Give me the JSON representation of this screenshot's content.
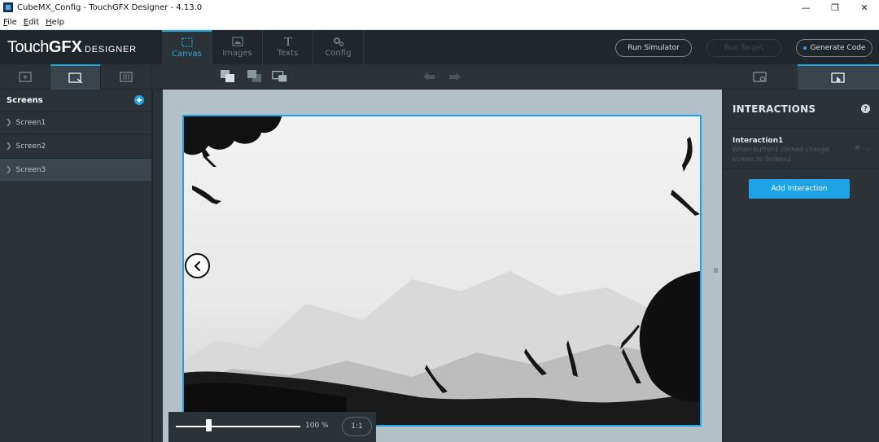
{
  "window": {
    "title": "CubeMX_Config - TouchGFX Designer - 4.13.0",
    "controls": [
      "—",
      "❐",
      "✕"
    ]
  },
  "menu": [
    "File",
    "Edit",
    "Help"
  ],
  "brand": {
    "part1": "Touch",
    "part2": "GFX",
    "part3": "DESIGNER"
  },
  "nav_tabs": [
    {
      "label": "Canvas",
      "icon": "canvas-icon",
      "active": true
    },
    {
      "label": "Images",
      "icon": "images-icon",
      "active": false
    },
    {
      "label": "Texts",
      "icon": "texts-icon",
      "active": false
    },
    {
      "label": "Config",
      "icon": "config-icon",
      "active": false
    }
  ],
  "header_buttons": {
    "run_simulator": "Run Simulator",
    "run_target": "Run Target",
    "generate_code": "Generate Code"
  },
  "screens_panel": {
    "title": "Screens",
    "screens": [
      {
        "label": "Screen1",
        "selected": false
      },
      {
        "label": "Screen2",
        "selected": false
      },
      {
        "label": "Screen3",
        "selected": true
      }
    ]
  },
  "zoom": {
    "value": "100 %",
    "reset_label": "1:1",
    "level": 0.25
  },
  "interactions_panel": {
    "title": "INTERACTIONS",
    "help": "?",
    "items": [
      {
        "name": "Interaction1",
        "description": "When button1 clicked change screen to Screen2"
      }
    ],
    "add_label": "Add Interaction"
  },
  "colors": {
    "accent": "#1fa3e7",
    "panel": "#2b3339",
    "header": "#1f272c",
    "canvas_bg": "#b4c0c8"
  }
}
